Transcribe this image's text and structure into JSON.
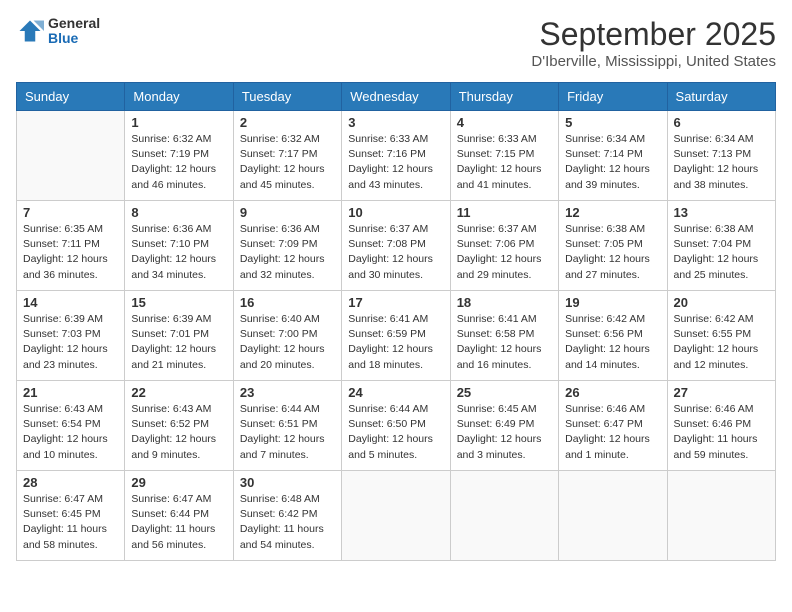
{
  "header": {
    "logo_general": "General",
    "logo_blue": "Blue",
    "month": "September 2025",
    "location": "D'Iberville, Mississippi, United States"
  },
  "days_of_week": [
    "Sunday",
    "Monday",
    "Tuesday",
    "Wednesday",
    "Thursday",
    "Friday",
    "Saturday"
  ],
  "weeks": [
    [
      {
        "day": "",
        "sunrise": "",
        "sunset": "",
        "daylight": ""
      },
      {
        "day": "1",
        "sunrise": "Sunrise: 6:32 AM",
        "sunset": "Sunset: 7:19 PM",
        "daylight": "Daylight: 12 hours and 46 minutes."
      },
      {
        "day": "2",
        "sunrise": "Sunrise: 6:32 AM",
        "sunset": "Sunset: 7:17 PM",
        "daylight": "Daylight: 12 hours and 45 minutes."
      },
      {
        "day": "3",
        "sunrise": "Sunrise: 6:33 AM",
        "sunset": "Sunset: 7:16 PM",
        "daylight": "Daylight: 12 hours and 43 minutes."
      },
      {
        "day": "4",
        "sunrise": "Sunrise: 6:33 AM",
        "sunset": "Sunset: 7:15 PM",
        "daylight": "Daylight: 12 hours and 41 minutes."
      },
      {
        "day": "5",
        "sunrise": "Sunrise: 6:34 AM",
        "sunset": "Sunset: 7:14 PM",
        "daylight": "Daylight: 12 hours and 39 minutes."
      },
      {
        "day": "6",
        "sunrise": "Sunrise: 6:34 AM",
        "sunset": "Sunset: 7:13 PM",
        "daylight": "Daylight: 12 hours and 38 minutes."
      }
    ],
    [
      {
        "day": "7",
        "sunrise": "Sunrise: 6:35 AM",
        "sunset": "Sunset: 7:11 PM",
        "daylight": "Daylight: 12 hours and 36 minutes."
      },
      {
        "day": "8",
        "sunrise": "Sunrise: 6:36 AM",
        "sunset": "Sunset: 7:10 PM",
        "daylight": "Daylight: 12 hours and 34 minutes."
      },
      {
        "day": "9",
        "sunrise": "Sunrise: 6:36 AM",
        "sunset": "Sunset: 7:09 PM",
        "daylight": "Daylight: 12 hours and 32 minutes."
      },
      {
        "day": "10",
        "sunrise": "Sunrise: 6:37 AM",
        "sunset": "Sunset: 7:08 PM",
        "daylight": "Daylight: 12 hours and 30 minutes."
      },
      {
        "day": "11",
        "sunrise": "Sunrise: 6:37 AM",
        "sunset": "Sunset: 7:06 PM",
        "daylight": "Daylight: 12 hours and 29 minutes."
      },
      {
        "day": "12",
        "sunrise": "Sunrise: 6:38 AM",
        "sunset": "Sunset: 7:05 PM",
        "daylight": "Daylight: 12 hours and 27 minutes."
      },
      {
        "day": "13",
        "sunrise": "Sunrise: 6:38 AM",
        "sunset": "Sunset: 7:04 PM",
        "daylight": "Daylight: 12 hours and 25 minutes."
      }
    ],
    [
      {
        "day": "14",
        "sunrise": "Sunrise: 6:39 AM",
        "sunset": "Sunset: 7:03 PM",
        "daylight": "Daylight: 12 hours and 23 minutes."
      },
      {
        "day": "15",
        "sunrise": "Sunrise: 6:39 AM",
        "sunset": "Sunset: 7:01 PM",
        "daylight": "Daylight: 12 hours and 21 minutes."
      },
      {
        "day": "16",
        "sunrise": "Sunrise: 6:40 AM",
        "sunset": "Sunset: 7:00 PM",
        "daylight": "Daylight: 12 hours and 20 minutes."
      },
      {
        "day": "17",
        "sunrise": "Sunrise: 6:41 AM",
        "sunset": "Sunset: 6:59 PM",
        "daylight": "Daylight: 12 hours and 18 minutes."
      },
      {
        "day": "18",
        "sunrise": "Sunrise: 6:41 AM",
        "sunset": "Sunset: 6:58 PM",
        "daylight": "Daylight: 12 hours and 16 minutes."
      },
      {
        "day": "19",
        "sunrise": "Sunrise: 6:42 AM",
        "sunset": "Sunset: 6:56 PM",
        "daylight": "Daylight: 12 hours and 14 minutes."
      },
      {
        "day": "20",
        "sunrise": "Sunrise: 6:42 AM",
        "sunset": "Sunset: 6:55 PM",
        "daylight": "Daylight: 12 hours and 12 minutes."
      }
    ],
    [
      {
        "day": "21",
        "sunrise": "Sunrise: 6:43 AM",
        "sunset": "Sunset: 6:54 PM",
        "daylight": "Daylight: 12 hours and 10 minutes."
      },
      {
        "day": "22",
        "sunrise": "Sunrise: 6:43 AM",
        "sunset": "Sunset: 6:52 PM",
        "daylight": "Daylight: 12 hours and 9 minutes."
      },
      {
        "day": "23",
        "sunrise": "Sunrise: 6:44 AM",
        "sunset": "Sunset: 6:51 PM",
        "daylight": "Daylight: 12 hours and 7 minutes."
      },
      {
        "day": "24",
        "sunrise": "Sunrise: 6:44 AM",
        "sunset": "Sunset: 6:50 PM",
        "daylight": "Daylight: 12 hours and 5 minutes."
      },
      {
        "day": "25",
        "sunrise": "Sunrise: 6:45 AM",
        "sunset": "Sunset: 6:49 PM",
        "daylight": "Daylight: 12 hours and 3 minutes."
      },
      {
        "day": "26",
        "sunrise": "Sunrise: 6:46 AM",
        "sunset": "Sunset: 6:47 PM",
        "daylight": "Daylight: 12 hours and 1 minute."
      },
      {
        "day": "27",
        "sunrise": "Sunrise: 6:46 AM",
        "sunset": "Sunset: 6:46 PM",
        "daylight": "Daylight: 11 hours and 59 minutes."
      }
    ],
    [
      {
        "day": "28",
        "sunrise": "Sunrise: 6:47 AM",
        "sunset": "Sunset: 6:45 PM",
        "daylight": "Daylight: 11 hours and 58 minutes."
      },
      {
        "day": "29",
        "sunrise": "Sunrise: 6:47 AM",
        "sunset": "Sunset: 6:44 PM",
        "daylight": "Daylight: 11 hours and 56 minutes."
      },
      {
        "day": "30",
        "sunrise": "Sunrise: 6:48 AM",
        "sunset": "Sunset: 6:42 PM",
        "daylight": "Daylight: 11 hours and 54 minutes."
      },
      {
        "day": "",
        "sunrise": "",
        "sunset": "",
        "daylight": ""
      },
      {
        "day": "",
        "sunrise": "",
        "sunset": "",
        "daylight": ""
      },
      {
        "day": "",
        "sunrise": "",
        "sunset": "",
        "daylight": ""
      },
      {
        "day": "",
        "sunrise": "",
        "sunset": "",
        "daylight": ""
      }
    ]
  ]
}
